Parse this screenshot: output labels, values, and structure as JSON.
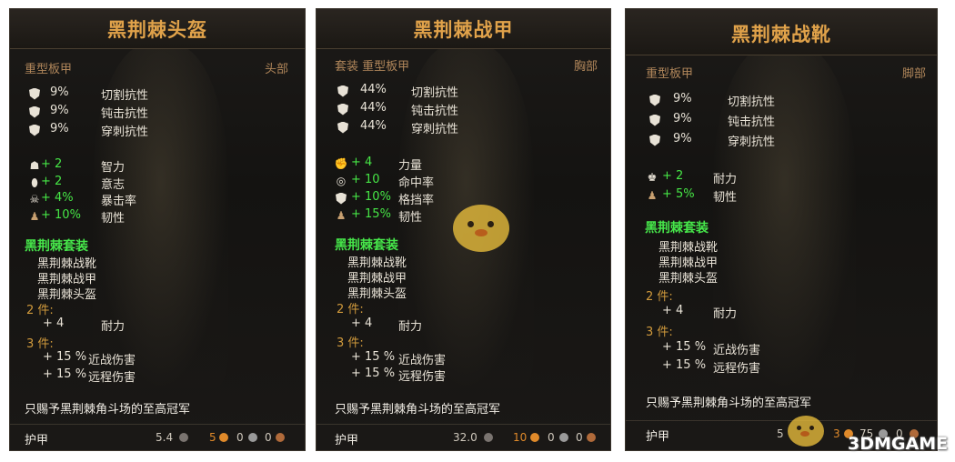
{
  "watermark": "3DMGAME",
  "cards": [
    {
      "title": "黑荆棘头盔",
      "category": "重型板甲",
      "slot": "头部",
      "resists": [
        {
          "icon": "slash-resist-icon",
          "value": "9%",
          "name": "切割抗性"
        },
        {
          "icon": "blunt-resist-icon",
          "value": "9%",
          "name": "钝击抗性"
        },
        {
          "icon": "pierce-resist-icon",
          "value": "9%",
          "name": "穿刺抗性"
        }
      ],
      "attrs": [
        {
          "icon": "intelligence-icon",
          "value": "+ 2",
          "name": "智力"
        },
        {
          "icon": "willpower-icon",
          "value": "+ 2",
          "name": "意志"
        },
        {
          "icon": "crit-icon",
          "value": "+ 4%",
          "name": "暴击率"
        },
        {
          "icon": "toughness-icon",
          "value": "+ 10%",
          "name": "韧性"
        }
      ],
      "set_name": "黑荆棘套装",
      "set_items": [
        "黑荆棘战靴",
        "黑荆棘战甲",
        "黑荆棘头盔"
      ],
      "tier2_label": "2 件:",
      "tier2_bonuses": [
        {
          "value": "+ 4",
          "name": "耐力"
        }
      ],
      "tier3_label": "3 件:",
      "tier3_bonuses": [
        {
          "value": "+ 15 %",
          "name": "近战伤害"
        },
        {
          "value": "+ 15 %",
          "name": "远程伤害"
        }
      ],
      "description": "只赐予黑荆棘角斗场的至高冠军",
      "armor_label": "护甲",
      "armor_value": "5.4",
      "coins": [
        {
          "n": "5",
          "color": "#e08a2a"
        },
        {
          "n": "0",
          "color": "#9a9a9a"
        },
        {
          "n": "0",
          "color": "#b06a3a"
        }
      ]
    },
    {
      "title": "黑荆棘战甲",
      "category": "套装 重型板甲",
      "slot": "胸部",
      "resists": [
        {
          "icon": "slash-resist-icon",
          "value": "44%",
          "name": "切割抗性"
        },
        {
          "icon": "blunt-resist-icon",
          "value": "44%",
          "name": "钝击抗性"
        },
        {
          "icon": "pierce-resist-icon",
          "value": "44%",
          "name": "穿刺抗性"
        }
      ],
      "attrs": [
        {
          "icon": "strength-icon",
          "value": "+ 4",
          "name": "力量"
        },
        {
          "icon": "accuracy-icon",
          "value": "+ 10",
          "name": "命中率"
        },
        {
          "icon": "block-icon",
          "value": "+ 10%",
          "name": "格挡率"
        },
        {
          "icon": "toughness-icon",
          "value": "+ 15%",
          "name": "韧性"
        }
      ],
      "set_name": "黑荆棘套装",
      "set_items": [
        "黑荆棘战靴",
        "黑荆棘战甲",
        "黑荆棘头盔"
      ],
      "tier2_label": "2 件:",
      "tier2_bonuses": [
        {
          "value": "+ 4",
          "name": "耐力"
        }
      ],
      "tier3_label": "3 件:",
      "tier3_bonuses": [
        {
          "value": "+ 15 %",
          "name": "近战伤害"
        },
        {
          "value": "+ 15 %",
          "name": "远程伤害"
        }
      ],
      "description": "只赐予黑荆棘角斗场的至高冠军",
      "armor_label": "护甲",
      "armor_value": "32.0",
      "coins": [
        {
          "n": "10",
          "color": "#e08a2a"
        },
        {
          "n": "0",
          "color": "#9a9a9a"
        },
        {
          "n": "0",
          "color": "#b06a3a"
        }
      ]
    },
    {
      "title": "黑荆棘战靴",
      "category": "重型板甲",
      "slot": "脚部",
      "resists": [
        {
          "icon": "slash-resist-icon",
          "value": "9%",
          "name": "切割抗性"
        },
        {
          "icon": "blunt-resist-icon",
          "value": "9%",
          "name": "钝击抗性"
        },
        {
          "icon": "pierce-resist-icon",
          "value": "9%",
          "name": "穿刺抗性"
        }
      ],
      "attrs": [
        {
          "icon": "stamina-icon",
          "value": "+ 2",
          "name": "耐力"
        },
        {
          "icon": "toughness-icon",
          "value": "+ 5%",
          "name": "韧性"
        }
      ],
      "set_name": "黑荆棘套装",
      "set_items": [
        "黑荆棘战靴",
        "黑荆棘战甲",
        "黑荆棘头盔"
      ],
      "tier2_label": "2 件:",
      "tier2_bonuses": [
        {
          "value": "+ 4",
          "name": "耐力"
        }
      ],
      "tier3_label": "3 件:",
      "tier3_bonuses": [
        {
          "value": "+ 15 %",
          "name": "近战伤害"
        },
        {
          "value": "+ 15 %",
          "name": "远程伤害"
        }
      ],
      "description": "只赐予黑荆棘角斗场的至高冠军",
      "armor_label": "护甲",
      "armor_value": "5",
      "coins": [
        {
          "n": "3",
          "color": "#e08a2a"
        },
        {
          "n": "75",
          "color": "#9a9a9a"
        },
        {
          "n": "0",
          "color": "#b06a3a"
        }
      ]
    }
  ]
}
